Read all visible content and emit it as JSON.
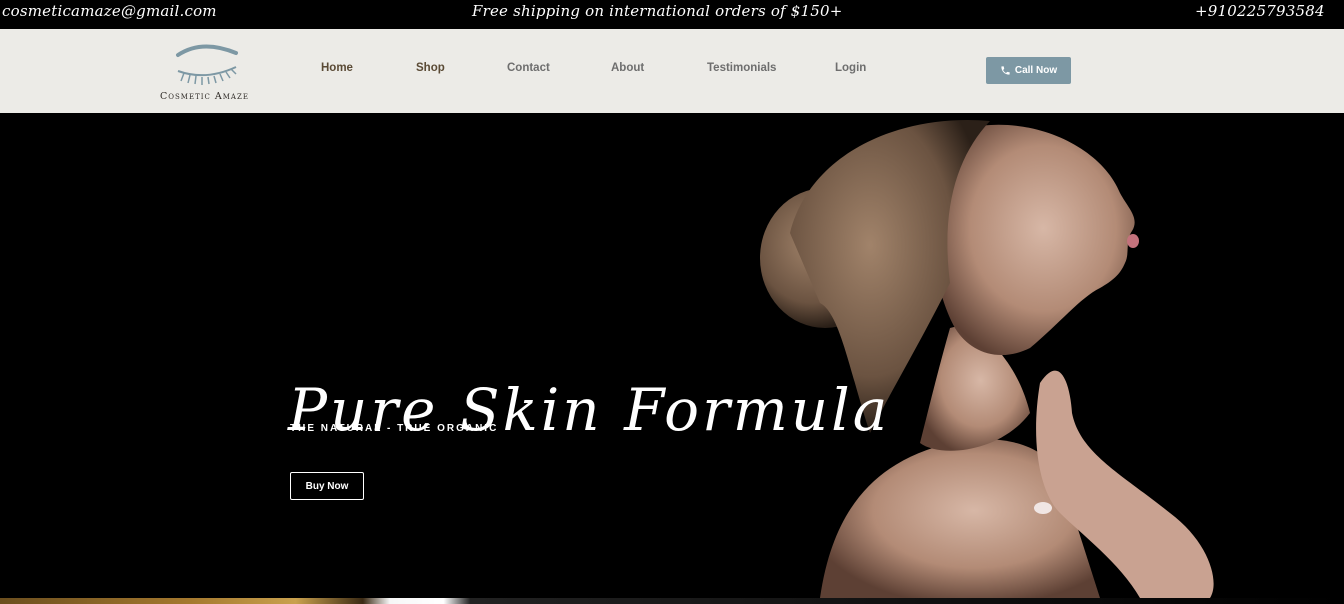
{
  "topbar": {
    "email": "cosmeticamaze@gmail.com",
    "shipping": "Free shipping on international orders of $150+",
    "phone": "+910225793584"
  },
  "header": {
    "logo_text": "Cosmetic Amaze",
    "nav": [
      "Home",
      "Shop",
      "Contact",
      "About",
      "Testimonials",
      "Login"
    ],
    "active_nav": "Home",
    "call_label": "Call Now"
  },
  "hero": {
    "title": "Pure Skin Formula",
    "subtitle": "THE NATURAL - TRUE ORGANIC",
    "button": "Buy Now"
  },
  "colors": {
    "topbar_bg": "#000000",
    "header_bg": "#ecebe7",
    "accent_button": "#7d98a4",
    "active_nav": "#5a4a35",
    "hero_bg": "#000000"
  },
  "icons": {
    "logo": "eyelash-eyebrow-logo",
    "call": "phone-icon"
  }
}
